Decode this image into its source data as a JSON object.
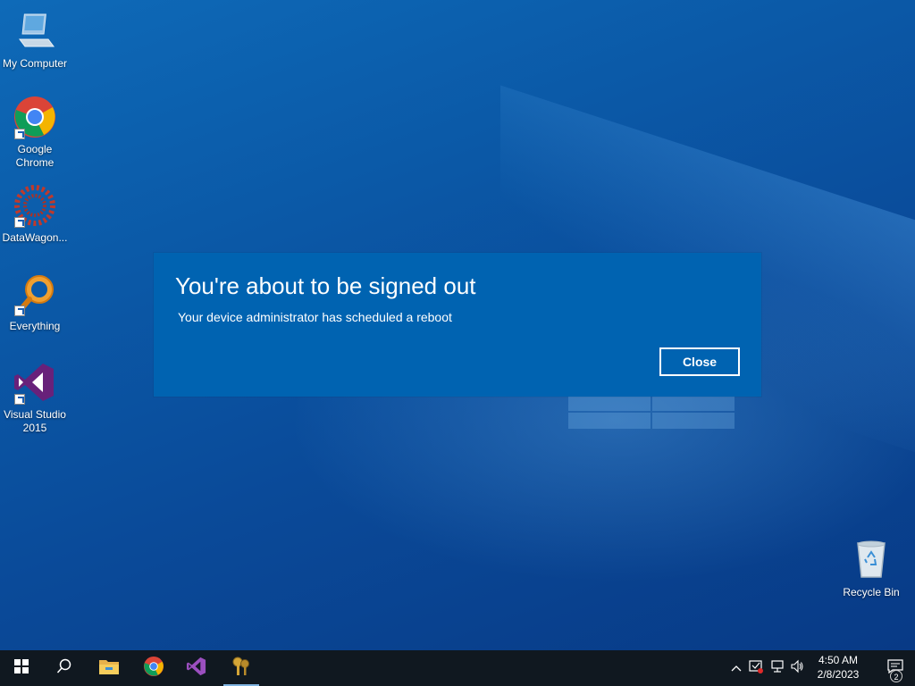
{
  "desktop": {
    "icons": [
      {
        "label": "My Computer"
      },
      {
        "label": "Google Chrome"
      },
      {
        "label": "DataWagon..."
      },
      {
        "label": "Everything"
      },
      {
        "label": "Visual Studio 2015"
      },
      {
        "label": "Recycle Bin"
      }
    ]
  },
  "dialog": {
    "title": "You're about to be signed out",
    "message": "Your device administrator has scheduled a reboot",
    "close_label": "Close"
  },
  "taskbar": {
    "items": [
      {
        "icon": "windows-start-icon"
      },
      {
        "icon": "search-icon"
      },
      {
        "icon": "file-explorer-icon"
      },
      {
        "icon": "chrome-icon"
      },
      {
        "icon": "visual-studio-icon"
      },
      {
        "icon": "keys-app-icon"
      }
    ],
    "clock": {
      "time": "4:50 AM",
      "date": "2/8/2023"
    },
    "notification_count": "2"
  },
  "colors": {
    "dialog_bg": "#0063b1",
    "taskbar_bg": "#101820",
    "desktop_bg": "#0b5aa8"
  }
}
